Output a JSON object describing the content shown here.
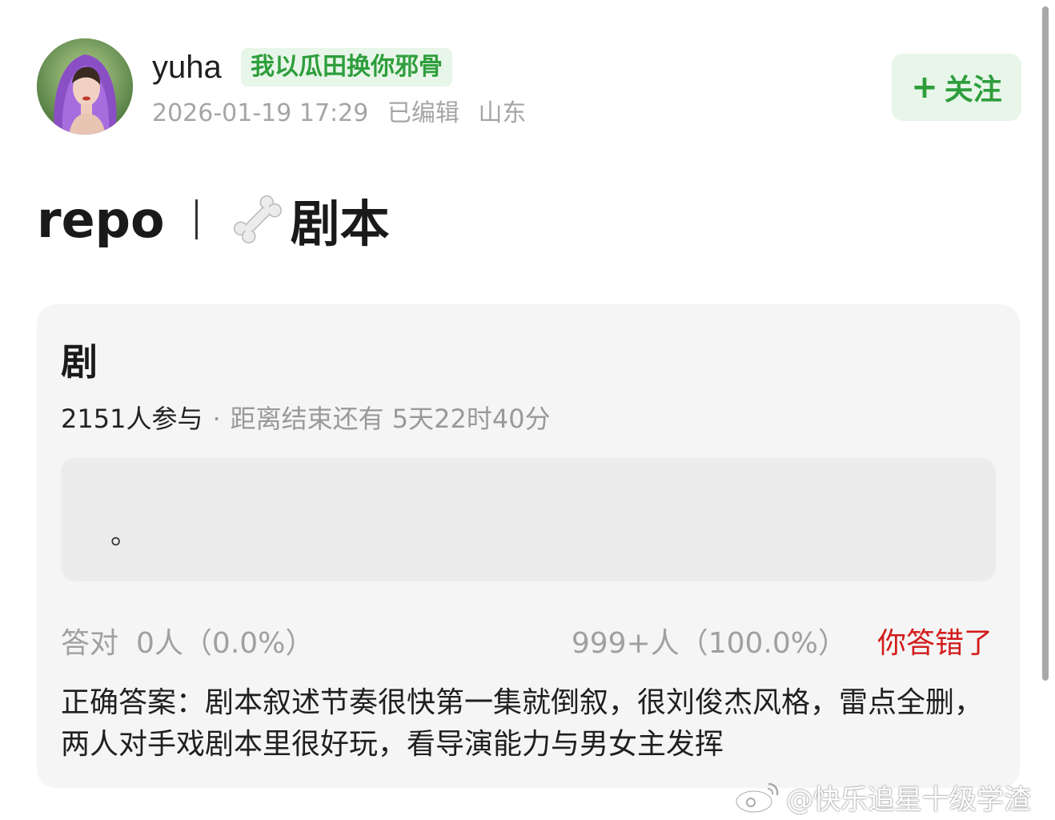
{
  "post": {
    "username": "yuha",
    "badge": "我以瓜田换你邪骨",
    "timestamp": "2026-01-19 17:29",
    "edited": "已编辑",
    "location": "山东",
    "follow_label": "关注",
    "title_left": "repo",
    "title_right": "剧本"
  },
  "quiz": {
    "title": "剧",
    "participants": "2151人参与",
    "remaining": "距离结束还有 5天22时40分",
    "option_text": "。",
    "correct_label": "答对",
    "correct_count": "0人（0.0%）",
    "wrong_count": "999+人（100.0%）",
    "result": "你答错了",
    "answer": "正确答案：剧本叙述节奏很快第一集就倒叙，很刘俊杰风格，雷点全删，两人对手戏剧本里很好玩，看导演能力与男女主发挥"
  },
  "watermark": "@快乐追星十级学渣",
  "colors": {
    "accent_green": "#2e9e3c",
    "badge_bg": "#e8f6e9",
    "wrong_red": "#d21b1b",
    "card_bg": "#f5f5f5"
  },
  "icons": [
    "avatar",
    "plus-icon",
    "bone-icon",
    "weibo-logo-icon"
  ]
}
